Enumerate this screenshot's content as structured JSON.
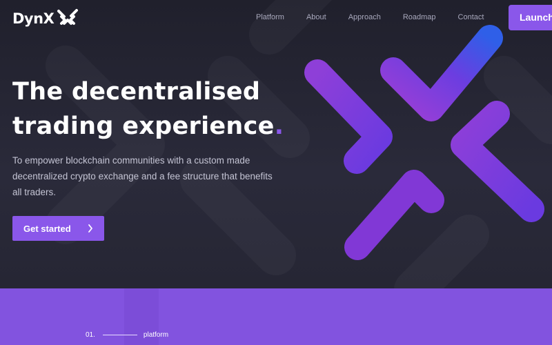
{
  "brand": {
    "name": "DynX"
  },
  "nav": {
    "items": [
      {
        "label": "Platform"
      },
      {
        "label": "About"
      },
      {
        "label": "Approach"
      },
      {
        "label": "Roadmap"
      },
      {
        "label": "Contact"
      }
    ],
    "launch_label": "Launch"
  },
  "hero": {
    "headline_line1": "The decentralised",
    "headline_line2": "trading experience",
    "headline_dot": ".",
    "subtitle": "To empower blockchain communities with a custom made decentralized crypto exchange and a fee structure that benefits all traders.",
    "cta_label": "Get started",
    "cta_icon": "chevron-right-icon"
  },
  "section": {
    "number": "01.",
    "label": "platform"
  },
  "colors": {
    "accent": "#8a57ea",
    "background": "#262634",
    "band": "#8253df"
  }
}
